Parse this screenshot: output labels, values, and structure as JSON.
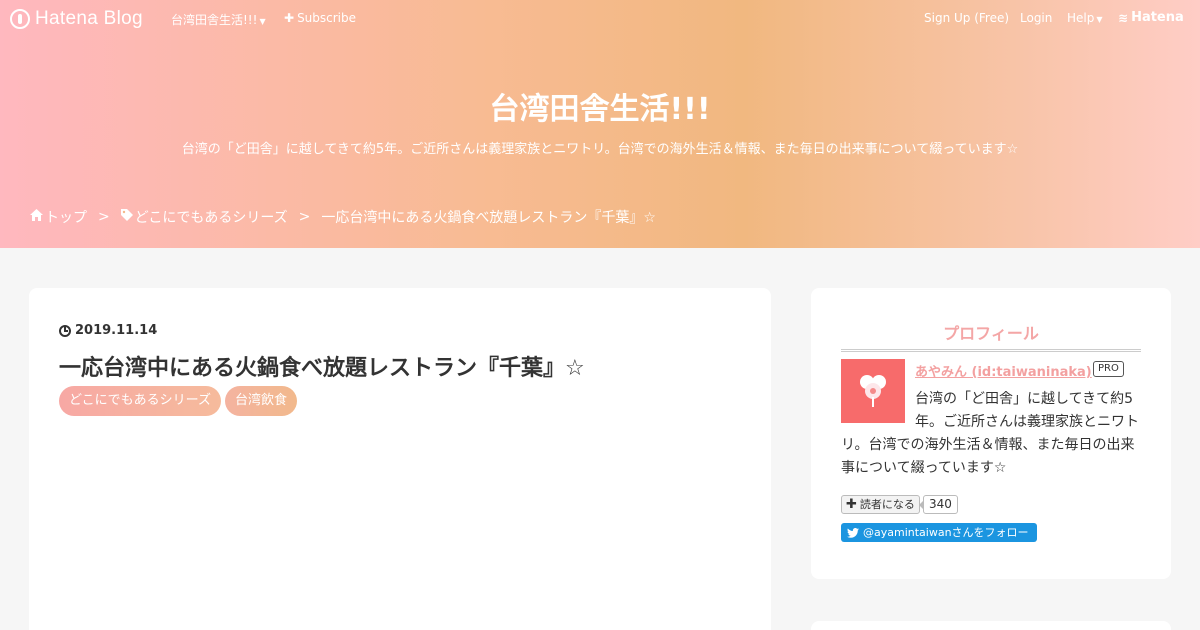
{
  "globalHeader": {
    "logo_text": "Hatena Blog",
    "blog_menu": "台湾田舎生活!!!",
    "subscribe": "Subscribe",
    "signup": "Sign Up (Free)",
    "login": "Login",
    "help": "Help",
    "hatena": "Hatena"
  },
  "blog": {
    "title": "台湾田舎生活!!!",
    "description": "台湾の「ど田舎」に越してきて約5年。ご近所さんは義理家族とニワトリ。台湾での海外生活＆情報、また毎日の出来事について綴っています☆"
  },
  "breadcrumb": {
    "home": "トップ",
    "sep": ">",
    "category": "どこにでもあるシリーズ",
    "current": "一応台湾中にある火鍋食べ放題レストラン『千葉』☆"
  },
  "article": {
    "date": "2019.11.14",
    "title": "一応台湾中にある火鍋食べ放題レストラン『千葉』☆",
    "categories": [
      "どこにでもあるシリーズ",
      "台湾飲食"
    ]
  },
  "sidebar": {
    "profile_title": "プロフィール",
    "name": "あやみん (id:taiwaninaka)",
    "badge": "PRO",
    "description": "台湾の「ど田舎」に越してきて約5年。ご近所さんは義理家族とニワトリ。台湾での海外生活＆情報、また毎日の出来事について綴っています☆",
    "subscribe_label": "読者になる",
    "subscribe_count": "340",
    "twitter_follow": "@ayamintaiwanさんをフォロー"
  },
  "colors": {
    "accent_pink": "#f4a6a6",
    "twitter_blue": "#1b95e0",
    "header_gradient_left": "#ffb8bf",
    "header_gradient_mid": "#f1b880"
  }
}
